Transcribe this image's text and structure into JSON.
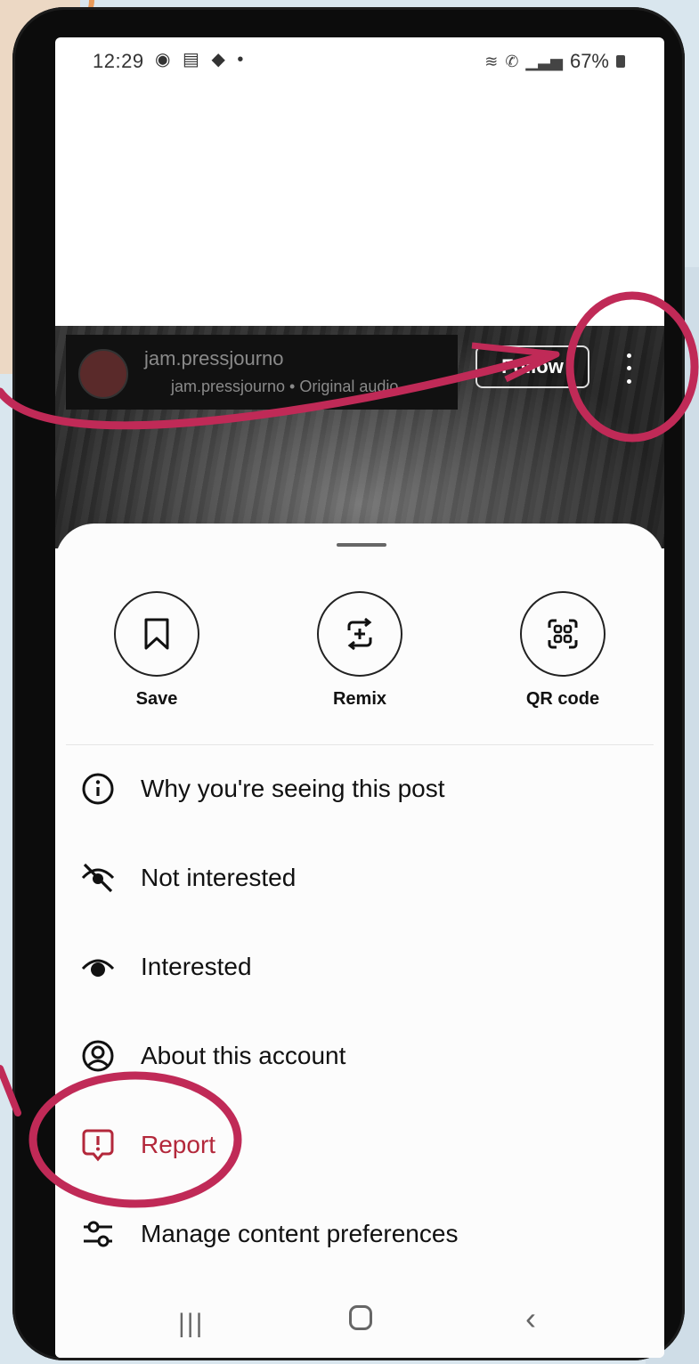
{
  "status_bar": {
    "time": "12:29",
    "battery": "67%"
  },
  "post": {
    "author_name": "jam.pressjourno",
    "author_sub": "jam.pressjourno • Original audio",
    "follow_label": "Follow"
  },
  "sheet": {
    "actions": [
      {
        "label": "Save",
        "icon": "bookmark-icon"
      },
      {
        "label": "Remix",
        "icon": "remix-icon"
      },
      {
        "label": "QR code",
        "icon": "qr-code-icon"
      }
    ],
    "menu": [
      {
        "label": "Why you're seeing this post",
        "icon": "info-icon"
      },
      {
        "label": "Not interested",
        "icon": "eye-off-icon"
      },
      {
        "label": "Interested",
        "icon": "eye-icon"
      },
      {
        "label": "About this account",
        "icon": "account-icon"
      },
      {
        "label": "Report",
        "icon": "report-icon",
        "color": "#b3283b"
      },
      {
        "label": "Manage content preferences",
        "icon": "sliders-icon"
      }
    ]
  },
  "annotation": {
    "color": "#c02a57"
  }
}
